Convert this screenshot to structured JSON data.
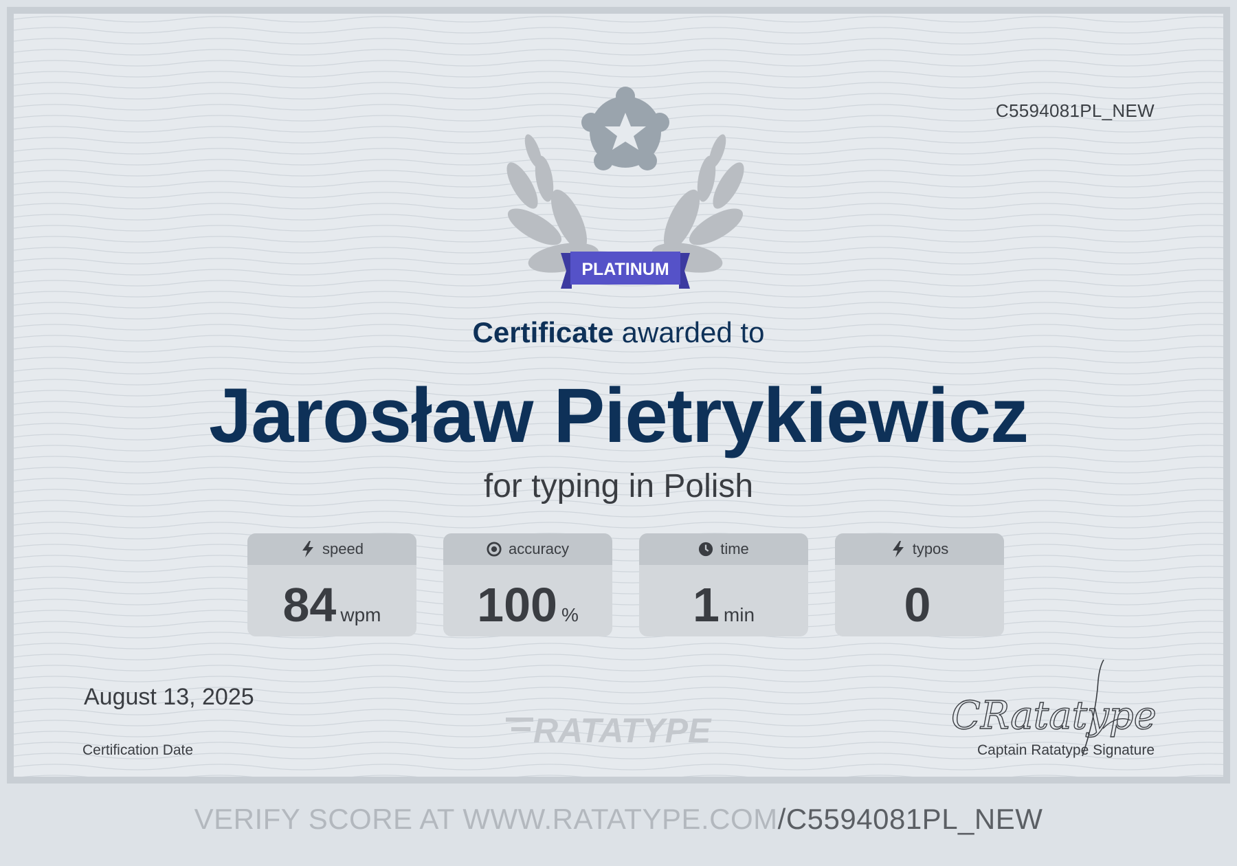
{
  "certificate": {
    "id": "C5594081PL_NEW",
    "level": "PLATINUM",
    "heading_strong": "Certificate",
    "heading_rest": "awarded to",
    "recipient": "Jarosław Pietrykiewicz",
    "subject": "for typing in Polish",
    "date": "August 13, 2025",
    "date_label": "Certification Date",
    "logo_text": "RATATYPE",
    "signature_text": "CRatatype",
    "signature_label": "Captain Ratatype Signature"
  },
  "stats": [
    {
      "icon": "lightning-icon",
      "label": "speed",
      "value": "84",
      "unit": "wpm"
    },
    {
      "icon": "target-icon",
      "label": "accuracy",
      "value": "100",
      "unit": "%"
    },
    {
      "icon": "clock-icon",
      "label": "time",
      "value": "1",
      "unit": "min"
    },
    {
      "icon": "lightning-icon",
      "label": "typos",
      "value": "0",
      "unit": ""
    }
  ],
  "footer": {
    "prefix": "VERIFY SCORE AT WWW.RATATYPE.COM",
    "code": "/C5594081PL_NEW"
  },
  "colors": {
    "navy": "#0e3158",
    "ribbon": "#5552c8",
    "text": "#3a3d42",
    "card": "#d3d7db",
    "card_header": "#c1c6cb"
  }
}
